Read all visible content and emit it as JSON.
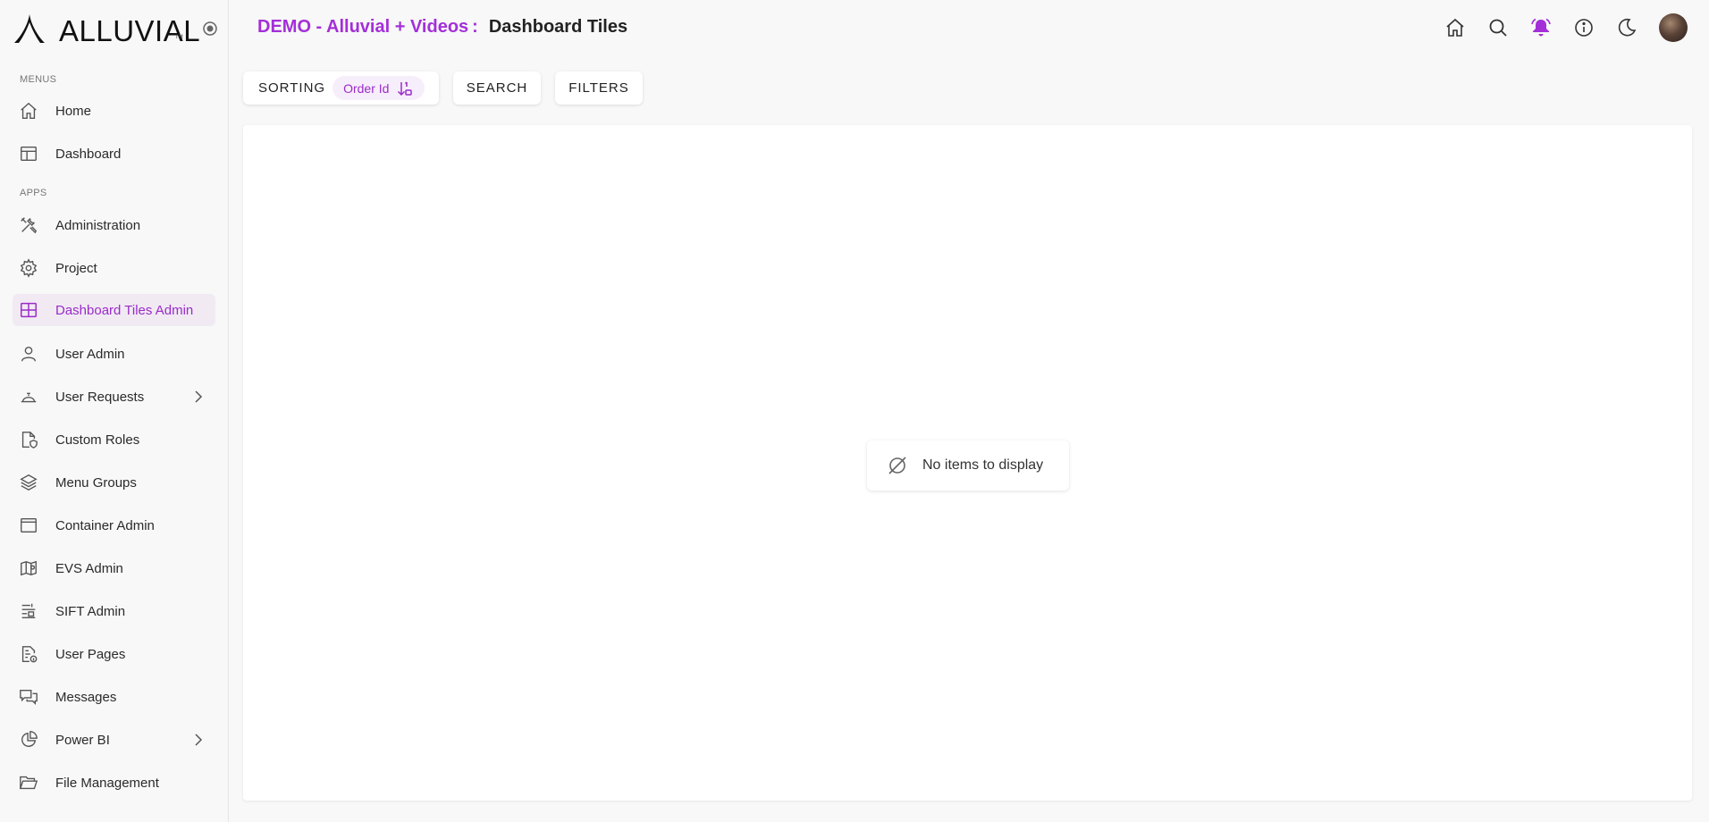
{
  "brand": {
    "logo_text": "ALLUVIAL",
    "tm": "TM"
  },
  "sidebar": {
    "sections": [
      {
        "label": "MENUS"
      },
      {
        "label": "APPS"
      }
    ],
    "items": [
      {
        "label": "Home",
        "icon": "home-icon"
      },
      {
        "label": "Dashboard",
        "icon": "dashboard-icon"
      },
      {
        "label": "Administration",
        "icon": "tools-icon"
      },
      {
        "label": "Project",
        "icon": "gear-icon"
      },
      {
        "label": "Dashboard Tiles Admin",
        "icon": "grid-icon",
        "active": true
      },
      {
        "label": "User Admin",
        "icon": "user-icon"
      },
      {
        "label": "User Requests",
        "icon": "request-icon",
        "expandable": true
      },
      {
        "label": "Custom Roles",
        "icon": "shield-file-icon"
      },
      {
        "label": "Menu Groups",
        "icon": "layers-icon"
      },
      {
        "label": "Container Admin",
        "icon": "window-icon"
      },
      {
        "label": "EVS Admin",
        "icon": "map-icon"
      },
      {
        "label": "SIFT Admin",
        "icon": "sift-icon"
      },
      {
        "label": "User Pages",
        "icon": "file-info-icon"
      },
      {
        "label": "Messages",
        "icon": "messages-icon"
      },
      {
        "label": "Power BI",
        "icon": "pie-chart-icon",
        "expandable": true
      },
      {
        "label": "File Management",
        "icon": "folder-icon"
      }
    ]
  },
  "header": {
    "brand_title": "DEMO - Alluvial + Videos",
    "separator": ":",
    "page_title": "Dashboard Tiles"
  },
  "toolbar": {
    "sorting_label": "SORTING",
    "sort_field": "Order Id",
    "search_label": "SEARCH",
    "filters_label": "FILTERS"
  },
  "content": {
    "empty_message": "No items to display"
  },
  "colors": {
    "accent": "#a42fd8",
    "active_bg": "#f1eaf3"
  }
}
